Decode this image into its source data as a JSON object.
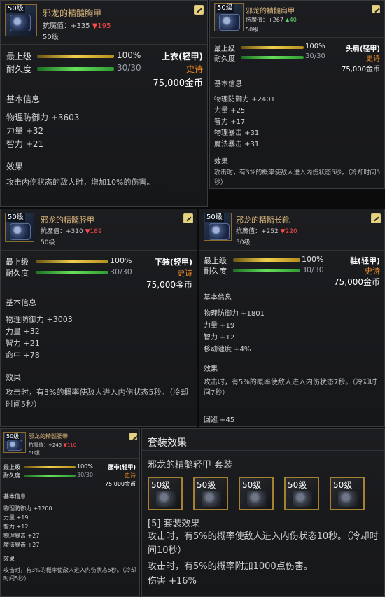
{
  "common": {
    "level_badge": "50级",
    "level_text": "50级",
    "max_level_label": "最上级",
    "durability_label": "耐久度",
    "basic_info_label": "基本信息",
    "effect_label": "效果",
    "magic_resist_prefix": "抗魔值：",
    "colors": {
      "name_gold": "#d9b57a",
      "rarity_orange": "#f08a24",
      "stat_up": "#5ed06b",
      "stat_down": "#ff4a4a"
    }
  },
  "items": [
    {
      "name": "邪龙的精髓胸甲",
      "magic_resist": "+335",
      "delta": "▼195",
      "delta_dir": "down",
      "max_pct": "100%",
      "max_fraction": 1.0,
      "durability": "30/30",
      "durability_fraction": 1.0,
      "slot": "上衣(轻甲)",
      "rarity": "史诗",
      "price": "75,000金币",
      "stats": [
        "物理防御力 +3603",
        "力量 +32",
        "智力 +21"
      ],
      "effect": "攻击内伤状态的敌人时，增加10%的伤害。",
      "icon": "chest-armor-icon"
    },
    {
      "name": "邪龙的精髓肩甲",
      "magic_resist": "+267",
      "delta": "▲40",
      "delta_dir": "up",
      "max_pct": "100%",
      "max_fraction": 1.0,
      "durability": "30/30",
      "durability_fraction": 1.0,
      "slot": "头肩(轻甲)",
      "rarity": "史诗",
      "price": "75,000金币",
      "stats": [
        "物理防御力 +2401",
        "力量 +25",
        "智力 +17",
        "物理暴击 +31",
        "魔法暴击 +31"
      ],
      "effect": "攻击时，有3%的概率使敌人进入内伤状态5秒。（冷却时间5秒）",
      "icon": "shoulder-armor-icon"
    },
    {
      "name": "邪龙的精髓胫甲",
      "magic_resist": "+310",
      "delta": "▼189",
      "delta_dir": "down",
      "max_pct": "100%",
      "max_fraction": 1.0,
      "durability": "30/30",
      "durability_fraction": 1.0,
      "slot": "下装(轻甲)",
      "rarity": "史诗",
      "price": "75,000金币",
      "stats": [
        "物理防御力 +3003",
        "力量 +32",
        "智力 +21",
        "命中 +78"
      ],
      "effect": "攻击时，有3%的概率使敌人进入内伤状态5秒。（冷却时间5秒）",
      "icon": "leg-armor-icon"
    },
    {
      "name": "邪龙的精髓长靴",
      "magic_resist": "+252",
      "delta": "▼220",
      "delta_dir": "down",
      "max_pct": "100%",
      "max_fraction": 1.0,
      "durability": "30/30",
      "durability_fraction": 1.0,
      "slot": "鞋(轻甲)",
      "rarity": "史诗",
      "price": "75,000金币",
      "stats": [
        "物理防御力 +1801",
        "力量 +19",
        "智力 +12",
        "移动速度 +4%"
      ],
      "effect": "攻击时，有5%的概率使敌人进入内伤状态7秒。（冷却时间7秒）",
      "extra": "回避 +45",
      "icon": "boots-icon"
    },
    {
      "name": "邪龙的精髓腰带",
      "magic_resist": "+245",
      "delta": "▼110",
      "delta_dir": "down",
      "max_pct": "100%",
      "max_fraction": 1.0,
      "durability": "30/30",
      "durability_fraction": 1.0,
      "slot": "腰带(轻甲)",
      "rarity": "史诗",
      "price": "75,000金币",
      "stats": [
        "物理防御力 +1200",
        "力量 +19",
        "智力 +12",
        "物理暴击 +27",
        "魔法暴击 +27"
      ],
      "effect": "攻击时，有3%的概率使敌人进入内伤状态5秒。（冷却时间5秒）",
      "icon": "belt-icon"
    }
  ],
  "set": {
    "title": "套装效果",
    "name": "邪龙的精髓轻甲  套装",
    "pieces": [
      "50级",
      "50级",
      "50级",
      "50级",
      "50级"
    ],
    "effect_header": "[5] 套装效果",
    "lines": [
      "攻击时，有5%的概率使敌人进入内伤状态10秒。（冷却时间10秒）",
      "攻击时，有5%的概率附加1000点伤害。",
      "伤害 +16%"
    ]
  }
}
